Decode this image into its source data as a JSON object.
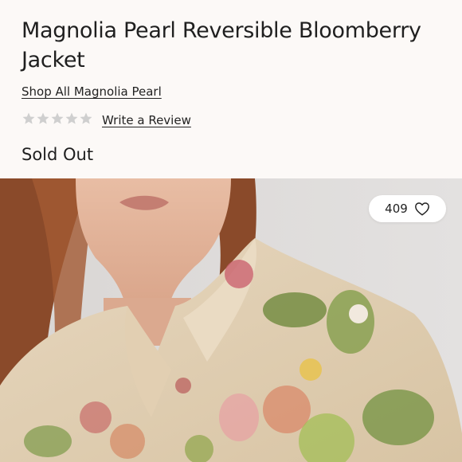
{
  "product": {
    "title": "Magnolia Pearl Reversible Bloomberry Jacket",
    "shop_link": "Shop All Magnolia Pearl",
    "rating": {
      "value": 0,
      "max": 5
    },
    "review_link": "Write a Review",
    "status": "Sold Out"
  },
  "image": {
    "favorites_count": "409"
  },
  "colors": {
    "background": "#fcf9f7",
    "star_empty": "#cfcfcf",
    "text": "#222222"
  }
}
